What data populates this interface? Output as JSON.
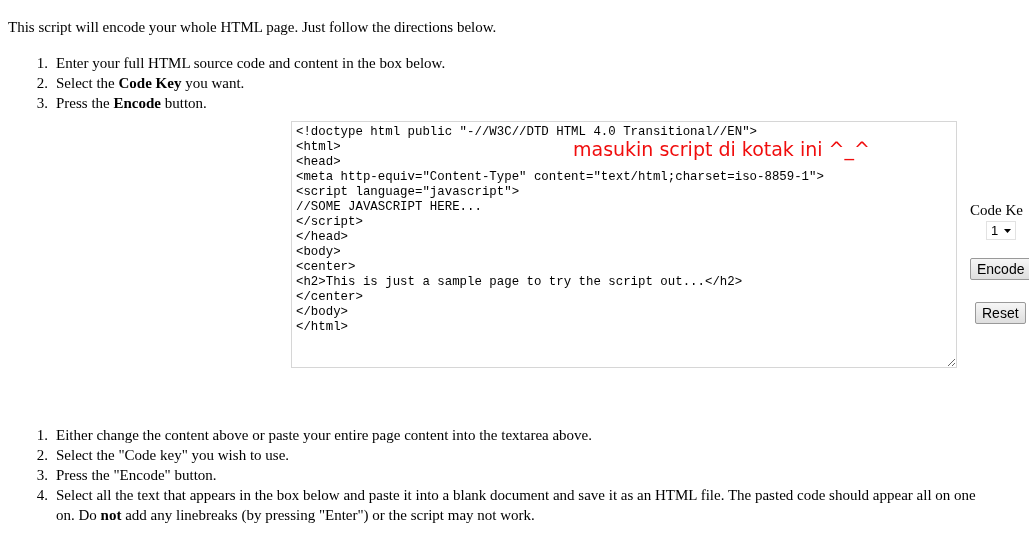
{
  "intro": "This script will encode your whole HTML page. Just follow the directions below.",
  "steps_top": [
    {
      "number": "1.",
      "text": "Enter your full HTML source code and content in the box below."
    },
    {
      "number": "2.",
      "text": "Select the **Code Key** you want."
    },
    {
      "number": "3.",
      "text": "Press the **Encode** button."
    }
  ],
  "source_box": {
    "value": "<!doctype html public \"-//W3C//DTD HTML 4.0 Transitional//EN\">\n<html>\n<head>\n<meta http-equiv=\"Content-Type\" content=\"text/html;charset=iso-8859-1\">\n<script language=\"javascript\">\n//SOME JAVASCRIPT HERE...\n</script>\n</head>\n<body>\n<center>\n<h2>This is just a sample page to try the script out...</h2>\n</center>\n</body>\n</html>",
    "annotation": "masukin script di kotak ini ^_^"
  },
  "code_key": {
    "label": "Code Ke",
    "value": "1"
  },
  "buttons": [
    "Encode",
    "Reset"
  ],
  "steps_bottom": [
    {
      "number": "1.",
      "text": "Either change the content above or paste your entire page content into the textarea above."
    },
    {
      "number": "2.",
      "text": "Select the \"Code key\" you wish to use."
    },
    {
      "number": "3.",
      "text": "Press the \"Encode\" button."
    },
    {
      "number": "4.",
      "text": "Select all the text that appears in the box below and paste it into a blank document and save it as an HTML file. The pasted code should appear all on one\non. Do **not** add any linebreaks (by pressing \"Enter\") or the script may not work."
    }
  ]
}
